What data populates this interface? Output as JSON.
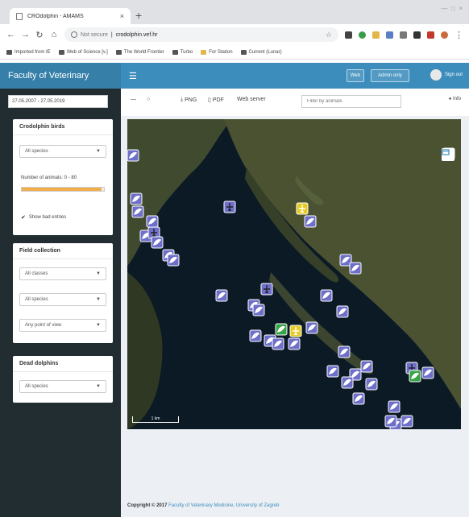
{
  "browser": {
    "tab_title": "CROdolphin - AMAMS",
    "tab_close": "×",
    "new_tab": "+",
    "url_insecure": "Not secure",
    "url": "crodolphin.vef.hr",
    "bookmarks": [
      {
        "label": "Imported from IE",
        "folder": true
      },
      {
        "label": "Web of Science [v.]",
        "folder": false
      },
      {
        "label": "The World Frontier",
        "folder": false
      },
      {
        "label": "Turbo",
        "folder": true
      },
      {
        "label": "For Station",
        "folder": true
      },
      {
        "label": "Current (Lunar)",
        "folder": false
      }
    ]
  },
  "header": {
    "brand": "Faculty of Veterinary",
    "button_1": "Web",
    "button_2": "Admin only",
    "user": "Sign out"
  },
  "sidebar": {
    "date_range": "27.05.2007 - 27.05.2019",
    "panels": {
      "birds": {
        "title": "Crodolphin birds",
        "species": "All species",
        "slider_label": "Number of animals: 0 - 80",
        "slider_fill": 0.97,
        "checkbox_label": "Show bad entries"
      },
      "field": {
        "title": "Field collection",
        "select_1": "All classes",
        "select_2": "All species",
        "select_3": "Any point of view"
      },
      "dead": {
        "title": "Dead dolphins",
        "species": "All species"
      }
    }
  },
  "toolbar": {
    "minus": "—",
    "refresh": "○",
    "png": "PNG",
    "pdf": "PDF",
    "web": "Web server",
    "filter_placeholder": "Filter by animals",
    "info": "Info"
  },
  "map": {
    "scale_label": "1 km",
    "colors": {
      "sea": "#0c1a26",
      "land": "#3f4a2e",
      "marker_purple": "#6e6fc9",
      "marker_yellow": "#e8cc26",
      "marker_green": "#37a446"
    }
  },
  "footer": {
    "prefix": "Copyright © 2017",
    "link": "Faculty of Veterinary Medicine, University of Zagreb"
  }
}
